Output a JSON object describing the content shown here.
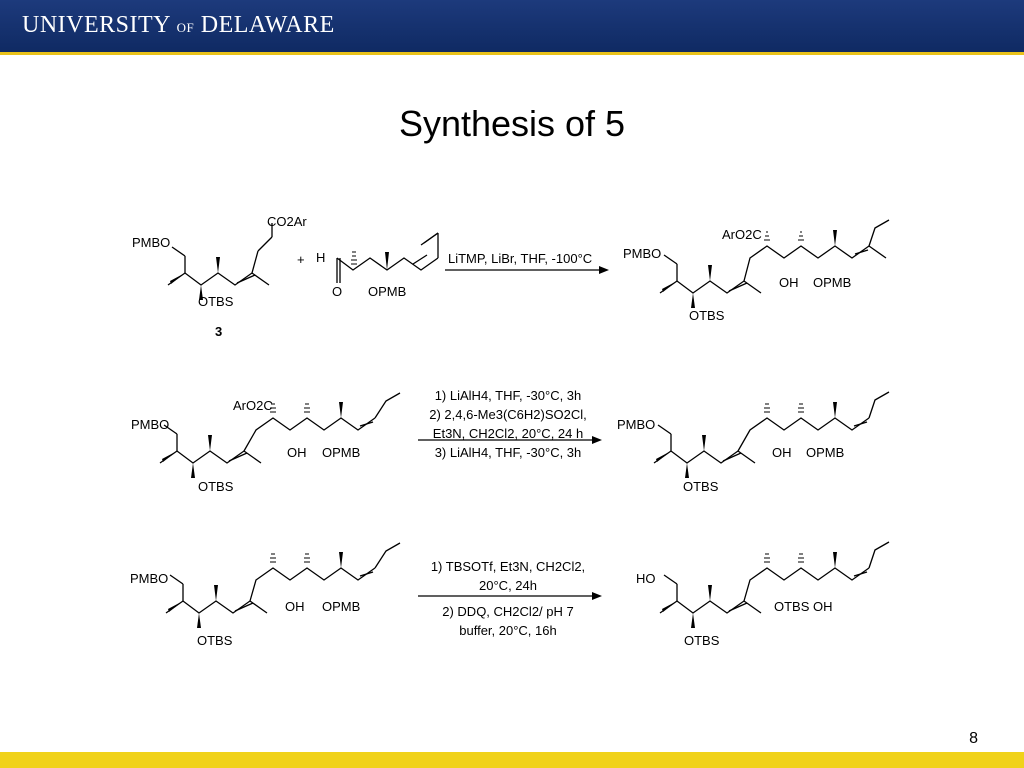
{
  "header": {
    "logo_text": "UNIVERSITY",
    "logo_of": "OF",
    "logo_text2": "DELAWARE"
  },
  "slide": {
    "title": "Synthesis of 5",
    "page_number": "8"
  },
  "labels": {
    "pmbo": "PMBO",
    "hob": "HO",
    "otbs": "OTBS",
    "oh": "OH",
    "opmb": "OPMB",
    "otbs_oh": "OTBS OH",
    "co2ar": "CO2Ar",
    "aro2c": "ArO2C",
    "h": "H",
    "o": "O",
    "plus": "+",
    "compound_3": "3"
  },
  "reaction1": {
    "conditions": "LiTMP, LiBr, THF, -100°C"
  },
  "reaction2": {
    "step1": "1) LiAlH4, THF, -30°C, 3h",
    "step2a": "2) 2,4,6-Me3(C6H2)SO2Cl,",
    "step2b": "Et3N, CH2Cl2, 20°C, 24 h",
    "step3": "3) LiAlH4, THF, -30°C, 3h"
  },
  "reaction3": {
    "step1a": "1) TBSOTf, Et3N, CH2Cl2,",
    "step1b": "20°C, 24h",
    "step2a": "2) DDQ, CH2Cl2/ pH 7",
    "step2b": "buffer, 20°C, 16h"
  },
  "colors": {
    "banner": "#1d3a7c",
    "gold": "#f0d21a"
  }
}
